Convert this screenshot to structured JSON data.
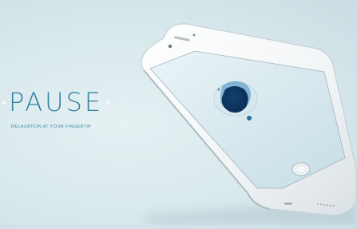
{
  "app": {
    "title": "PAUSE",
    "tagline": "RELAXATION AT YOUR FINGERTIP"
  },
  "colors": {
    "background": "#d6e7eb",
    "brand": "#2f7f9e",
    "screen_tint": "#d8e9ee",
    "blob_dark": "#0d3d6c",
    "blob_mid": "#3c89bf"
  },
  "icons": {
    "home_button": "home-button-icon",
    "decorative_dots": "dot-icon"
  }
}
